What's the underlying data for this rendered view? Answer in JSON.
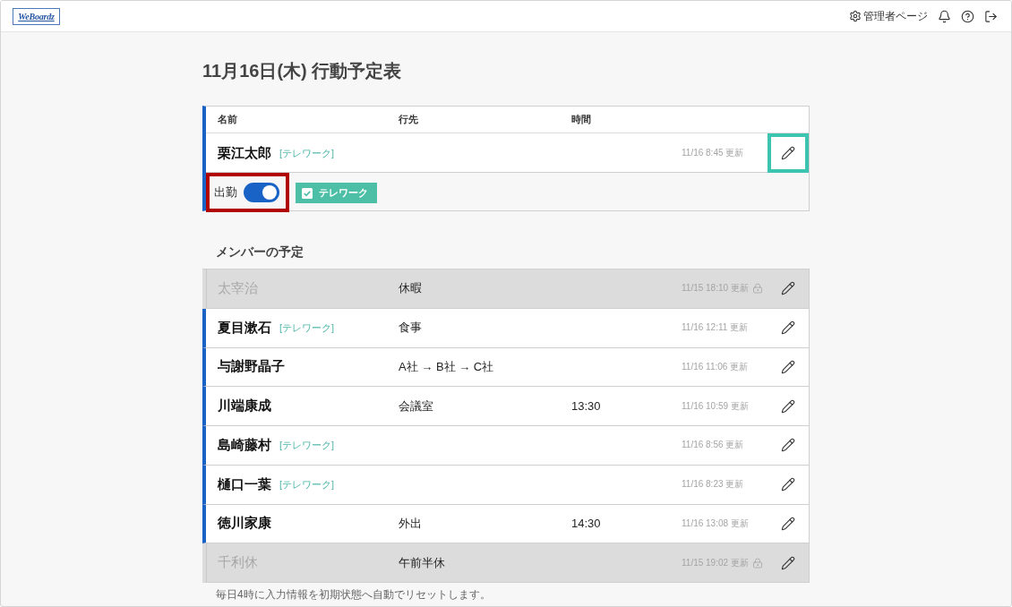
{
  "header": {
    "logo": "WeBoardz",
    "admin_link": "管理者ページ"
  },
  "title": "11月16日(木) 行動予定表",
  "my_status": {
    "columns": [
      "名前",
      "行先",
      "時間"
    ],
    "row": {
      "name": "栗江太郎",
      "tag": "[テレワーク]",
      "updated": "11/16 8:45 更新",
      "present": true,
      "highlighted": true
    },
    "attendance": {
      "label": "出勤",
      "on": true,
      "highlighted": true
    },
    "telework": {
      "label": "テレワーク",
      "checked": true
    }
  },
  "members_title": "メンバーの予定",
  "members": [
    {
      "name": "太宰治",
      "destination": "休暇",
      "updated": "11/15 18:10 更新",
      "present": false,
      "locked": true
    },
    {
      "name": "夏目漱石",
      "tag": "[テレワーク]",
      "destination": "食事",
      "updated": "11/16 12:11 更新",
      "present": true,
      "locked": false
    },
    {
      "name": "与謝野晶子",
      "destination": "A社 → B社 → C社",
      "updated": "11/16 11:06 更新",
      "present": true,
      "locked": false
    },
    {
      "name": "川端康成",
      "destination": "会議室",
      "time": "13:30",
      "updated": "11/16 10:59 更新",
      "present": true,
      "locked": false
    },
    {
      "name": "島崎藤村",
      "tag": "[テレワーク]",
      "updated": "11/16 8:56 更新",
      "present": true,
      "locked": false
    },
    {
      "name": "樋口一葉",
      "tag": "[テレワーク]",
      "updated": "11/16 8:23 更新",
      "present": true,
      "locked": false
    },
    {
      "name": "徳川家康",
      "destination": "外出",
      "time": "14:30",
      "updated": "11/16 13:08 更新",
      "present": true,
      "locked": false
    },
    {
      "name": "千利休",
      "destination": "午前半休",
      "updated": "11/15 19:02 更新",
      "present": false,
      "locked": true
    }
  ],
  "note": "毎日4時に入力情報を初期状態へ自動でリセットします。"
}
